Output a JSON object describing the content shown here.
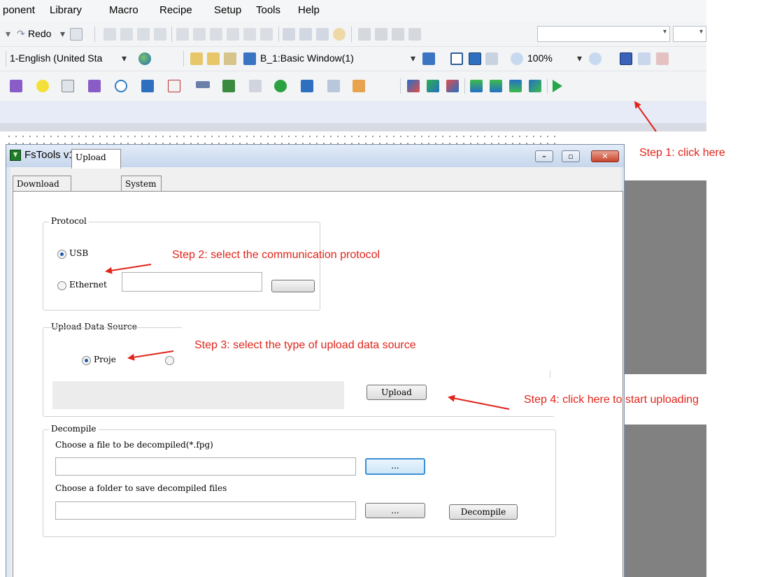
{
  "menu": {
    "items": [
      "ponent",
      "Library",
      "Macro",
      "Recipe",
      "Setup",
      "Tools",
      "Help"
    ]
  },
  "toolbar": {
    "redo_label": "Redo",
    "language_value": "1-English (United Sta",
    "window_value": "B_1:Basic Window(1)",
    "zoom_value": "100%"
  },
  "fstools": {
    "title": "FsTools v1.4.4",
    "tabs": [
      "Download",
      "Upload",
      "System"
    ],
    "active_tab": "Upload",
    "protocol": {
      "legend": "Protocol",
      "usb_label": "USB",
      "ethernet_label": "Ethernet",
      "selected": "USB"
    },
    "upload_source": {
      "legend": "Upload Data Source",
      "project_label": "Proje",
      "selected": "Project",
      "upload_button": "Upload"
    },
    "decompile": {
      "legend": "Decompile",
      "file_label": "Choose a file to be decompiled(*.fpg)",
      "folder_label": "Choose a folder to save decompiled files",
      "browse_button": "...",
      "decompile_button": "Decompile"
    }
  },
  "annotations": {
    "step1": "Step 1: click here",
    "step2": "Step 2: select the communication protocol",
    "step3": "Step 3: select the type of upload data source",
    "step4": "Step 4: click here to start uploading",
    "color": "#e0251b"
  }
}
